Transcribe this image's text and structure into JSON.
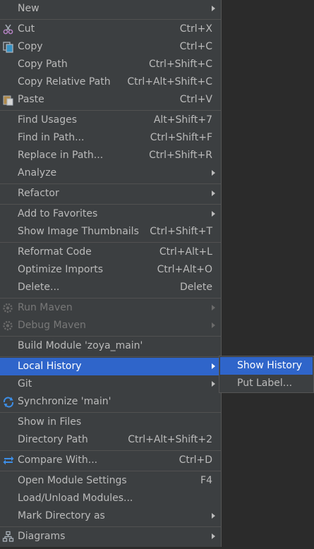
{
  "menu": {
    "items": [
      {
        "label": "New",
        "shortcut": "",
        "submenu": true
      },
      {
        "label": "Cut",
        "shortcut": "Ctrl+X",
        "icon": "scissors-icon"
      },
      {
        "label": "Copy",
        "shortcut": "Ctrl+C",
        "icon": "copy-icon"
      },
      {
        "label": "Copy Path",
        "shortcut": "Ctrl+Shift+C"
      },
      {
        "label": "Copy Relative Path",
        "shortcut": "Ctrl+Alt+Shift+C"
      },
      {
        "label": "Paste",
        "shortcut": "Ctrl+V",
        "icon": "paste-icon"
      },
      {
        "label": "Find Usages",
        "shortcut": "Alt+Shift+7"
      },
      {
        "label": "Find in Path...",
        "shortcut": "Ctrl+Shift+F"
      },
      {
        "label": "Replace in Path...",
        "shortcut": "Ctrl+Shift+R"
      },
      {
        "label": "Analyze",
        "shortcut": "",
        "submenu": true
      },
      {
        "label": "Refactor",
        "shortcut": "",
        "submenu": true
      },
      {
        "label": "Add to Favorites",
        "shortcut": "",
        "submenu": true
      },
      {
        "label": "Show Image Thumbnails",
        "shortcut": "Ctrl+Shift+T"
      },
      {
        "label": "Reformat Code",
        "shortcut": "Ctrl+Alt+L"
      },
      {
        "label": "Optimize Imports",
        "shortcut": "Ctrl+Alt+O"
      },
      {
        "label": "Delete...",
        "shortcut": "Delete"
      },
      {
        "label": "Run Maven",
        "shortcut": "",
        "submenu": true,
        "disabled": true,
        "icon": "gear-icon"
      },
      {
        "label": "Debug Maven",
        "shortcut": "",
        "submenu": true,
        "disabled": true,
        "icon": "gear-icon"
      },
      {
        "label": "Build Module 'zoya_main'",
        "shortcut": ""
      },
      {
        "label": "Local History",
        "shortcut": "",
        "submenu": true,
        "selected": true
      },
      {
        "label": "Git",
        "shortcut": "",
        "submenu": true
      },
      {
        "label": "Synchronize 'main'",
        "shortcut": "",
        "icon": "sync-icon"
      },
      {
        "label": "Show in Files",
        "shortcut": ""
      },
      {
        "label": "Directory Path",
        "shortcut": "Ctrl+Alt+Shift+2"
      },
      {
        "label": "Compare With...",
        "shortcut": "Ctrl+D",
        "icon": "compare-icon"
      },
      {
        "label": "Open Module Settings",
        "shortcut": "F4"
      },
      {
        "label": "Load/Unload Modules...",
        "shortcut": ""
      },
      {
        "label": "Mark Directory as",
        "shortcut": "",
        "submenu": true
      },
      {
        "label": "Diagrams",
        "shortcut": "",
        "submenu": true,
        "icon": "diagram-icon"
      }
    ]
  },
  "submenu": {
    "items": [
      {
        "label": "Show History",
        "selected": true
      },
      {
        "label": "Put Label..."
      }
    ]
  },
  "colors": {
    "menu_background": "#3c3f41",
    "selection": "#2f65ca",
    "text": "#bbbbbb",
    "disabled_text": "#787878",
    "separator": "#515151"
  }
}
